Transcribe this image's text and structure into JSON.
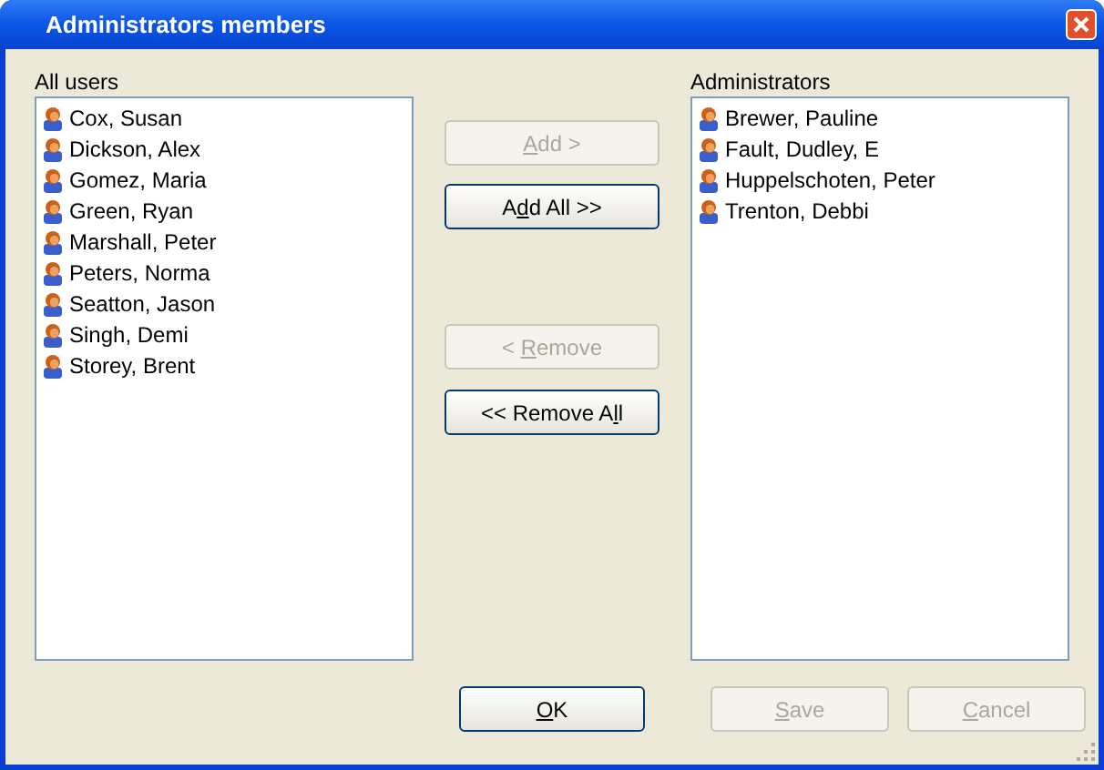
{
  "window": {
    "title": "Administrators members"
  },
  "all_users": {
    "label": "All users",
    "items": [
      {
        "name": "Cox, Susan"
      },
      {
        "name": "Dickson, Alex"
      },
      {
        "name": "Gomez, Maria"
      },
      {
        "name": "Green, Ryan"
      },
      {
        "name": "Marshall, Peter"
      },
      {
        "name": "Peters, Norma"
      },
      {
        "name": "Seatton, Jason"
      },
      {
        "name": "Singh, Demi"
      },
      {
        "name": "Storey, Brent"
      }
    ]
  },
  "transfer_buttons": [
    {
      "access_key": "A",
      "label_end": "dd >",
      "disabled": true
    },
    {
      "label_start": "A",
      "access_key": "d",
      "label_end": "d All >>",
      "disabled": false
    },
    {
      "label_start": "< ",
      "access_key": "R",
      "label_end": "emove",
      "disabled": true
    },
    {
      "label_start": "<< Remove A",
      "access_key": "l",
      "label_end": "l",
      "disabled": false
    }
  ],
  "administrators": {
    "label": "Administrators",
    "items": [
      {
        "name": "Brewer, Pauline"
      },
      {
        "name": "Fault, Dudley, E"
      },
      {
        "name": "Huppelschoten, Peter"
      },
      {
        "name": "Trenton, Debbi"
      }
    ]
  },
  "dialog_buttons": [
    {
      "access_key": "O",
      "label_end": "K",
      "disabled": false
    },
    {
      "access_key": "S",
      "label_end": "ave",
      "disabled": true
    },
    {
      "access_key": "C",
      "label_end": "ancel",
      "disabled": true
    }
  ]
}
